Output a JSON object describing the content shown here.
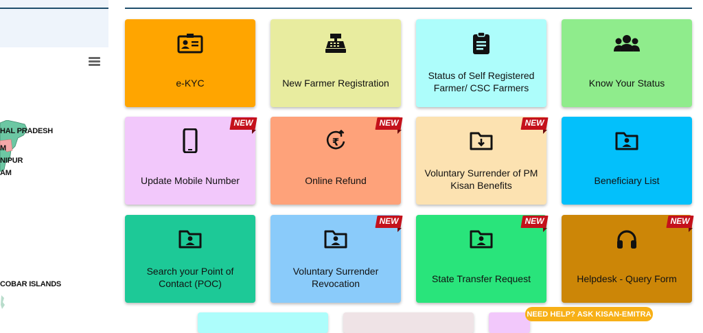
{
  "map": {
    "labels": [
      "HAL PRADESH",
      "M",
      "NIPUR",
      "AM",
      "COBAR ISLANDS"
    ]
  },
  "tiles": [
    {
      "label": "e-KYC",
      "icon": "id-card-icon",
      "color": "#ffa500",
      "new": false
    },
    {
      "label": "New Farmer Registration",
      "icon": "cash-register-icon",
      "color": "#e8ec9f",
      "new": false
    },
    {
      "label": "Status of Self Registered Farmer/ CSC Farmers",
      "icon": "clipboard-icon",
      "color": "#adfdfb",
      "new": false
    },
    {
      "label": "Know Your Status",
      "icon": "users-icon",
      "color": "#8fec8c",
      "new": false
    },
    {
      "label": "Update Mobile Number",
      "icon": "mobile-phone-icon",
      "color": "#f2c8fb",
      "new": true
    },
    {
      "label": "Online Refund",
      "icon": "rupee-refund-icon",
      "color": "#fea27a",
      "new": true
    },
    {
      "label": "Voluntary Surrender of PM Kisan Benefits",
      "icon": "folder-download-icon",
      "color": "#fce2b1",
      "new": true
    },
    {
      "label": "Beneficiary List",
      "icon": "folder-user-icon",
      "color": "#03c0fb",
      "new": false
    },
    {
      "label": "Search your Point of Contact (POC)",
      "icon": "folder-user-icon",
      "color": "#1dc997",
      "new": false
    },
    {
      "label": "Voluntary Surrender Revocation",
      "icon": "folder-user-icon",
      "color": "#8acbfa",
      "new": true
    },
    {
      "label": "State Transfer Request",
      "icon": "folder-user-icon",
      "color": "#29e47b",
      "new": true
    },
    {
      "label": "Helpdesk - Query Form",
      "icon": "headphones-icon",
      "color": "#cc8607",
      "new": true
    }
  ],
  "badge_text": "NEW",
  "help_text": "NEED HELP? ASK KISAN-EMITRA",
  "colors": {
    "accent_line": "#1d4d6b",
    "badge": "#c4111b",
    "help": "#f7b017"
  }
}
